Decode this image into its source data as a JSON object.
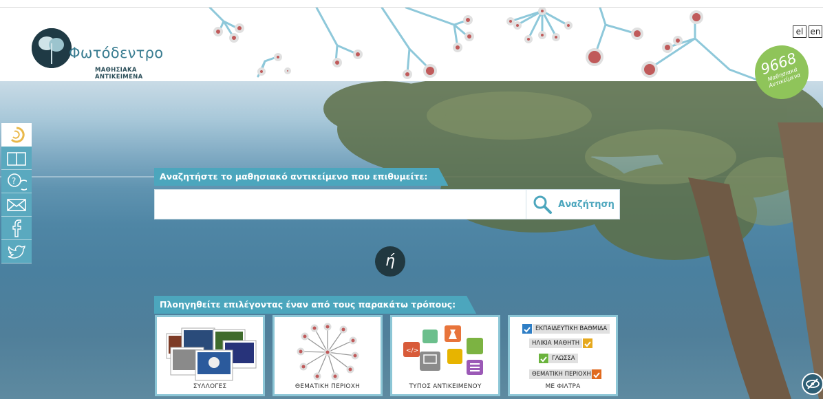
{
  "header": {
    "logo_title": "Φωτόδεντρο",
    "logo_subtitle": "ΜΑΘΗΣΙΑΚΑ ΑΝΤΙΚΕΙΜΕΝΑ",
    "lang_el": "el",
    "lang_en": "en",
    "badge_count": "9668",
    "badge_label_1": "Μαθησιακά",
    "badge_label_2": "Αντικείμενα"
  },
  "sidebar": {
    "items": [
      {
        "icon": "photodentro-icon"
      },
      {
        "icon": "book-icon"
      },
      {
        "icon": "help-chat-icon"
      },
      {
        "icon": "mail-icon"
      },
      {
        "icon": "facebook-icon"
      },
      {
        "icon": "twitter-icon"
      }
    ]
  },
  "search": {
    "label": "Αναζητήστε το μαθησιακό αντικείμενο που επιθυμείτε:",
    "value": "",
    "placeholder": "",
    "button_label": "Αναζήτηση"
  },
  "or_label": "ή",
  "browse": {
    "label": "Πλοηγηθείτε επιλέγοντας έναν από τους παρακάτω τρόπους:",
    "cards": [
      {
        "caption": "ΣΥΛΛΟΓΕΣ"
      },
      {
        "caption": "ΘΕΜΑΤΙΚΗ ΠΕΡΙΟΧΗ"
      },
      {
        "caption": "ΤΥΠΟΣ ΑΝΤΙΚΕΙΜΕΝΟΥ"
      },
      {
        "caption": "ΜΕ ΦΙΛΤΡΑ"
      }
    ],
    "filters": [
      "ΕΚΠΑΙΔΕΥΤΙΚΗ ΒΑΘΜΙΔΑ",
      "ΗΛΙΚΙΑ ΜΑΘΗΤΗ",
      "ΓΛΩΣΣΑ",
      "ΘΕΜΑΤΙΚΗ ΠΕΡΙΟΧΗ"
    ]
  },
  "colors": {
    "accent": "#4ca6bd",
    "badge": "#8fc45a",
    "dark": "#213840",
    "node": "#c05a5a"
  }
}
